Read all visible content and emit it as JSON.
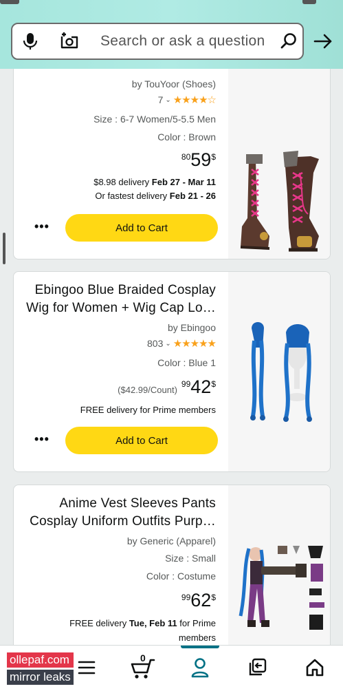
{
  "search": {
    "placeholder": "Search or ask a question"
  },
  "products": [
    {
      "title_line1": "",
      "title_line2": "",
      "brand": "by TouYoor (Shoes)",
      "rating_count": "7",
      "size": "Size : 6-7 Women/5-5.5 Men",
      "color": "Color : Brown",
      "price_symbol": "$",
      "price_whole": "59",
      "price_fraction": "80",
      "unit_price": "",
      "delivery_line1_prefix": "$8.98 delivery ",
      "delivery_line1_bold": "Feb 27 - Mar 11",
      "delivery_line2_prefix": "Or fastest delivery ",
      "delivery_line2_bold": "Feb 21 - 26",
      "add_to_cart": "Add to Cart",
      "more": "•••"
    },
    {
      "title_line1": "Ebingoo Blue Braided Cosplay",
      "title_line2": "Wig for Women + Wig Cap Lo…",
      "brand": "by Ebingoo",
      "rating_count": "803",
      "size": "",
      "color": "Color : Blue 1",
      "price_symbol": "$",
      "price_whole": "42",
      "price_fraction": "99",
      "unit_price": "($42.99/Count)",
      "delivery_line1_prefix": "FREE delivery for Prime members",
      "delivery_line1_bold": "",
      "delivery_line2_prefix": "",
      "delivery_line2_bold": "",
      "add_to_cart": "Add to Cart",
      "more": "•••"
    },
    {
      "title_line1": "Anime Vest Sleeves Pants",
      "title_line2": "Cosplay Uniform Outfits Purp…",
      "brand": "by Generic (Apparel)",
      "rating_count": "",
      "size": "Size : Small",
      "color": "Color : Costume",
      "price_symbol": "$",
      "price_whole": "62",
      "price_fraction": "99",
      "unit_price": "",
      "delivery_line1_prefix": "FREE delivery ",
      "delivery_line1_bold": "Tue, Feb 11",
      "delivery_line1_suffix": " for Prime",
      "delivery_line2_prefix": "members",
      "delivery_line2_bold": "",
      "add_to_cart": "Add to Cart",
      "more": "•••"
    }
  ],
  "nav": {
    "cart_count": "0",
    "active_tab": "account"
  },
  "watermark": {
    "line1": "ollepaf.com",
    "line2": "mirror leaks"
  },
  "colors": {
    "accent_teal": "#007185",
    "cart_yellow": "#ffd814",
    "star_orange": "#f9a11b",
    "header": "#a6e6dd"
  },
  "icons": [
    "microphone-icon",
    "camera-search-icon",
    "search-icon",
    "arrow-icon",
    "menu-icon",
    "cart-icon",
    "account-icon",
    "switch-icon",
    "home-icon"
  ]
}
